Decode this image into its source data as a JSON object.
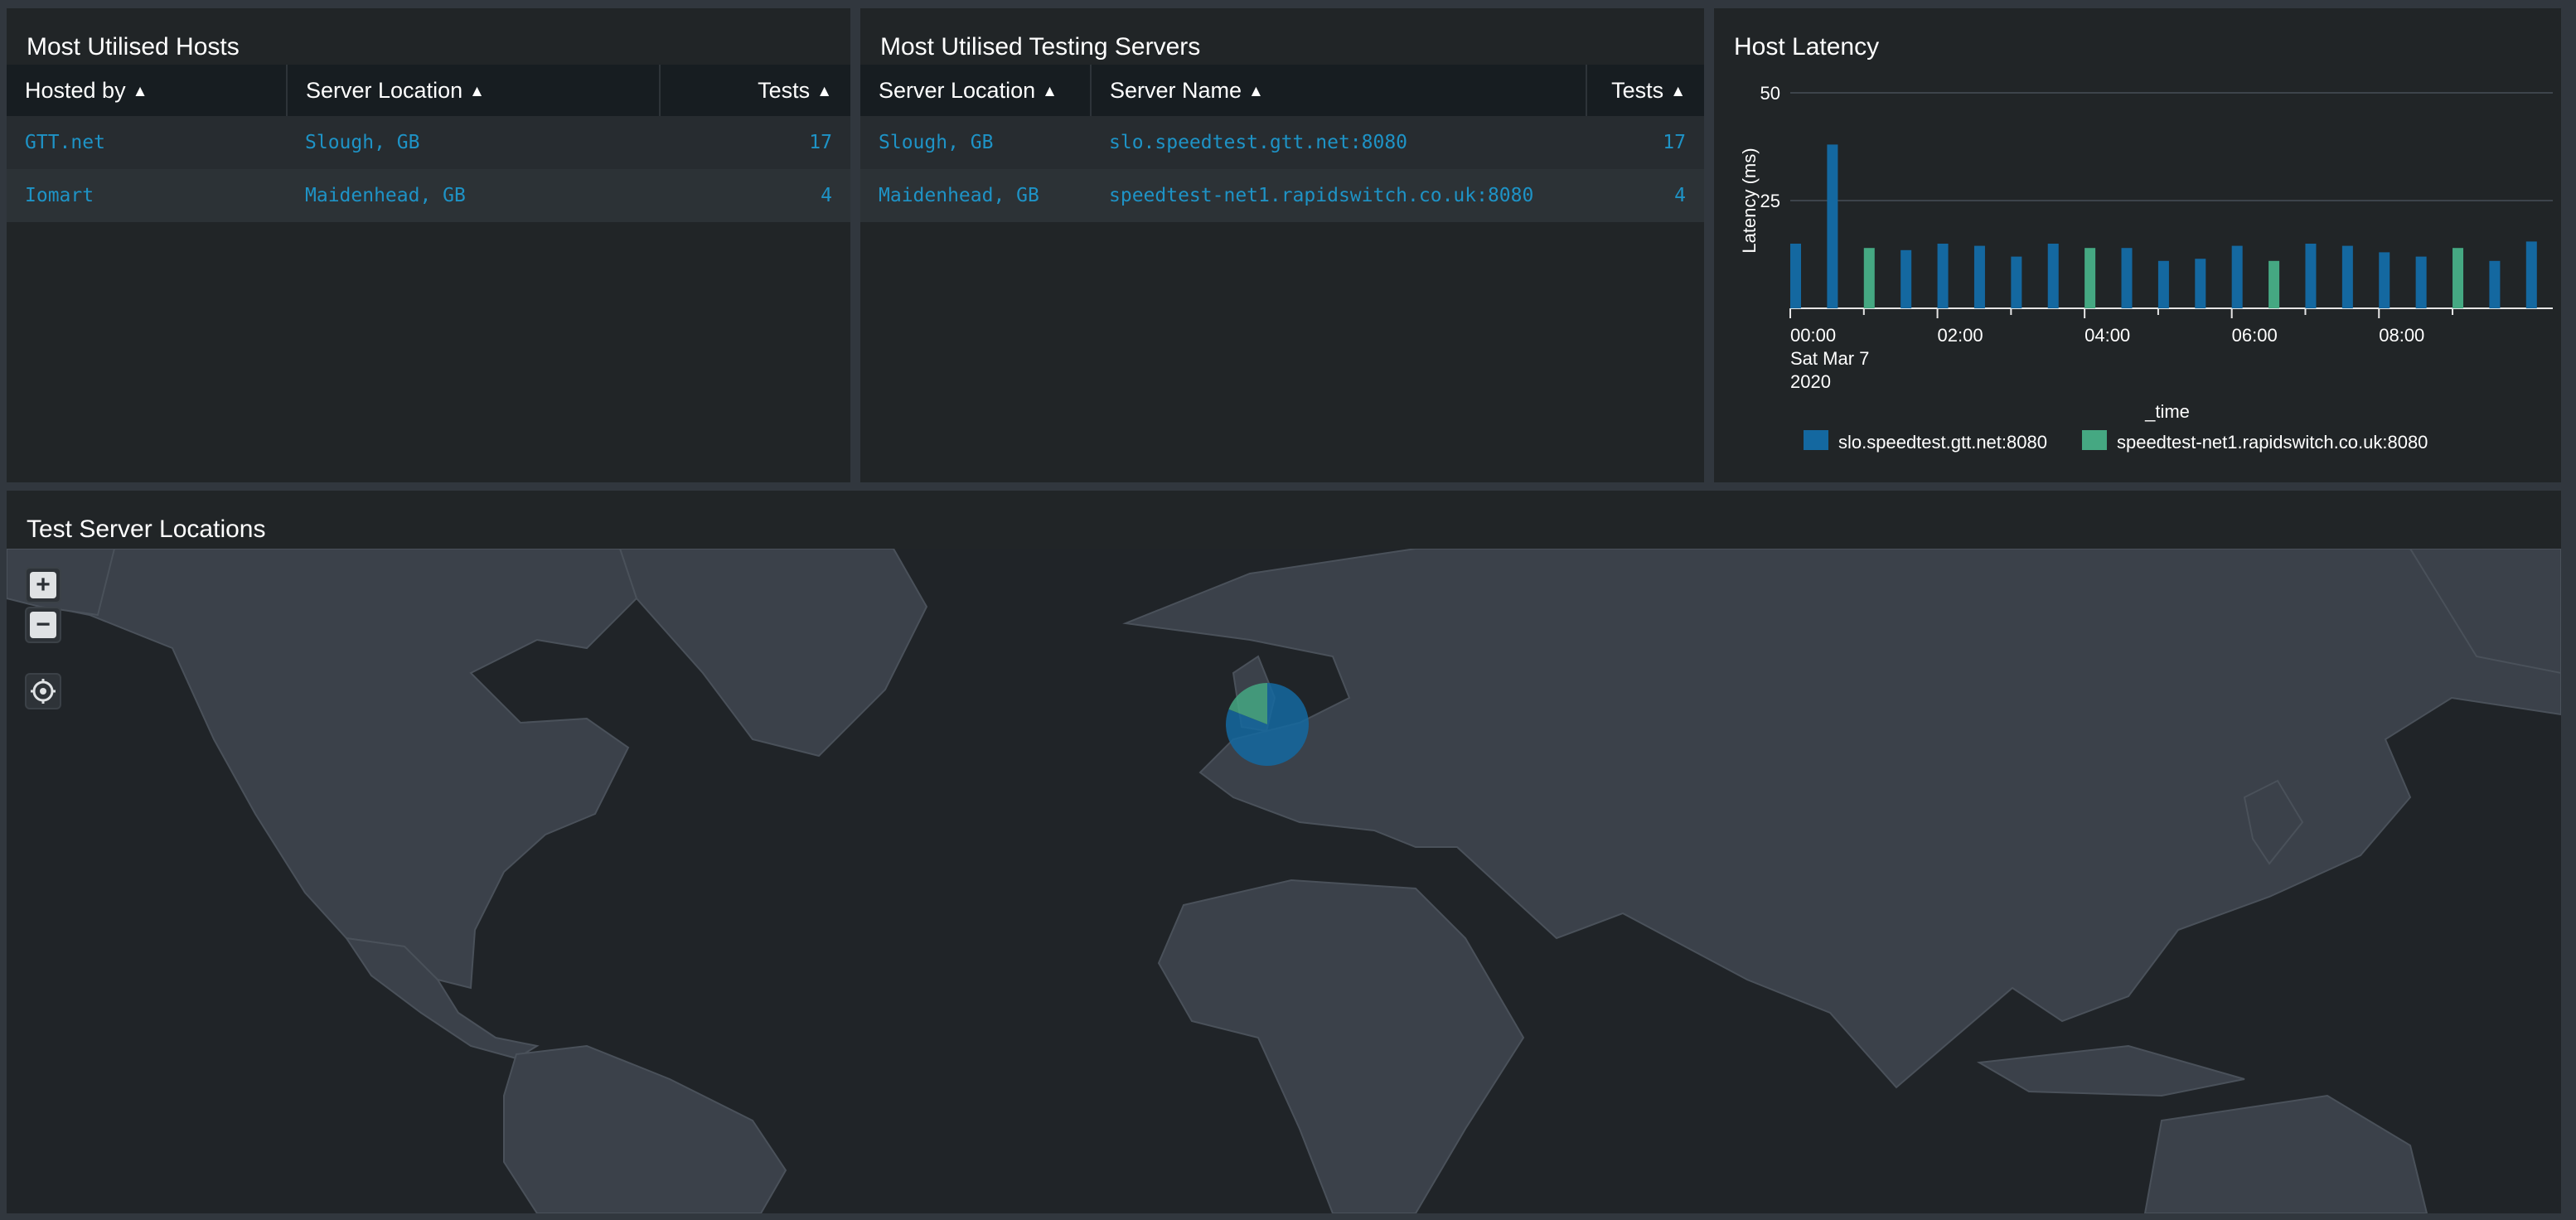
{
  "hosts_panel": {
    "title": "Most Utilised Hosts",
    "columns": [
      "Hosted by",
      "Server Location",
      "Tests"
    ],
    "rows": [
      [
        "GTT.net",
        "Slough, GB",
        "17"
      ],
      [
        "Iomart",
        "Maidenhead, GB",
        "4"
      ]
    ]
  },
  "servers_panel": {
    "title": "Most Utilised Testing Servers",
    "columns": [
      "Server Location",
      "Server Name",
      "Tests"
    ],
    "rows": [
      [
        "Slough, GB",
        "slo.speedtest.gtt.net:8080",
        "17"
      ],
      [
        "Maidenhead, GB",
        "speedtest-net1.rapidswitch.co.uk:8080",
        "4"
      ]
    ]
  },
  "latency_panel": {
    "title": "Host Latency",
    "chart_data": {
      "type": "bar",
      "title": "Host Latency",
      "xlabel": "_time",
      "ylabel": "Latency (ms)",
      "ylim": [
        0,
        50
      ],
      "y_ticks": [
        "25",
        "50"
      ],
      "x_ticks": [
        "00:00",
        "02:00",
        "04:00",
        "06:00",
        "08:00"
      ],
      "x_tick_date_lines": [
        "Sat Mar 7",
        "2020"
      ],
      "grid": true,
      "legend_placement": "bottom",
      "series": [
        {
          "name": "slo.speedtest.gtt.net:8080",
          "color": "#1468a0",
          "points": [
            {
              "t": "00:00",
              "v": 15
            },
            {
              "t": "00:30",
              "v": 38
            },
            {
              "t": "01:30",
              "v": 13.5
            },
            {
              "t": "02:00",
              "v": 15
            },
            {
              "t": "02:30",
              "v": 14.5
            },
            {
              "t": "03:00",
              "v": 12
            },
            {
              "t": "03:30",
              "v": 15
            },
            {
              "t": "04:30",
              "v": 14
            },
            {
              "t": "05:00",
              "v": 11
            },
            {
              "t": "05:30",
              "v": 11.5
            },
            {
              "t": "06:00",
              "v": 14.5
            },
            {
              "t": "07:00",
              "v": 15
            },
            {
              "t": "07:30",
              "v": 14.5
            },
            {
              "t": "08:00",
              "v": 13
            },
            {
              "t": "08:30",
              "v": 12
            },
            {
              "t": "09:30",
              "v": 11
            },
            {
              "t": "10:00",
              "v": 15.5
            }
          ]
        },
        {
          "name": "speedtest-net1.rapidswitch.co.uk:8080",
          "color": "#45a882",
          "points": [
            {
              "t": "01:00",
              "v": 14
            },
            {
              "t": "04:00",
              "v": 14
            },
            {
              "t": "06:30",
              "v": 11
            },
            {
              "t": "09:00",
              "v": 14
            }
          ]
        }
      ]
    }
  },
  "map_panel": {
    "title": "Test Server Locations",
    "controls": {
      "zoom_in": "zoom-in-icon",
      "zoom_out": "zoom-out-icon",
      "locate": "locate-icon"
    },
    "marker": {
      "location": "Slough, GB / Maidenhead, GB",
      "slices": [
        {
          "name": "slo.speedtest.gtt.net:8080",
          "value": 17,
          "color": "#1468a0"
        },
        {
          "name": "speedtest-net1.rapidswitch.co.uk:8080",
          "value": 4,
          "color": "#45a882"
        }
      ]
    }
  }
}
